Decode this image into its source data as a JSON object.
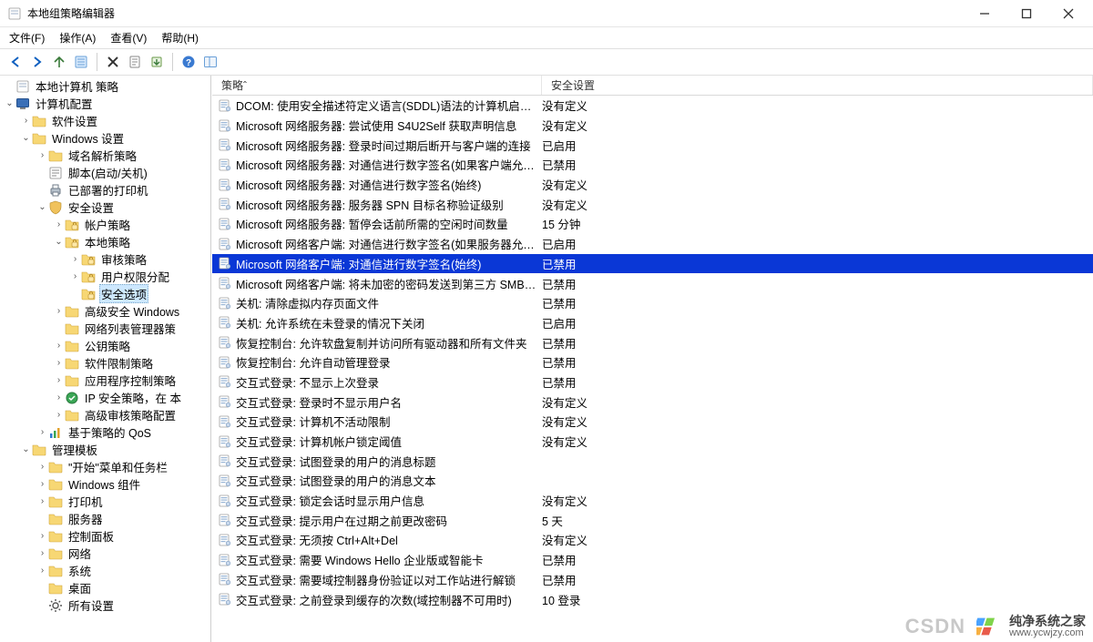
{
  "window": {
    "title": "本地组策略编辑器",
    "min_tooltip": "最小化",
    "max_tooltip": "最大化",
    "close_tooltip": "关闭"
  },
  "menu": {
    "file": "文件(F)",
    "action": "操作(A)",
    "view": "查看(V)",
    "help": "帮助(H)"
  },
  "toolbar_icons": [
    "nav-back-icon",
    "nav-forward-icon",
    "nav-up-icon",
    "list-icon",
    "sep",
    "delete-icon",
    "properties-icon",
    "export-icon",
    "sep",
    "help-icon",
    "show-hide-icon"
  ],
  "tree": [
    {
      "depth": 0,
      "expand": "none",
      "icon": "policy-root-icon",
      "label": "本地计算机 策略"
    },
    {
      "depth": 0,
      "expand": "open",
      "icon": "computer-config-icon",
      "label": "计算机配置"
    },
    {
      "depth": 1,
      "expand": "closed",
      "icon": "folder-icon",
      "label": "软件设置"
    },
    {
      "depth": 1,
      "expand": "open",
      "icon": "folder-icon",
      "label": "Windows 设置"
    },
    {
      "depth": 2,
      "expand": "closed",
      "icon": "folder-icon",
      "label": "域名解析策略"
    },
    {
      "depth": 2,
      "expand": "none",
      "icon": "script-icon",
      "label": "脚本(启动/关机)"
    },
    {
      "depth": 2,
      "expand": "none",
      "icon": "printer-icon",
      "label": "已部署的打印机"
    },
    {
      "depth": 2,
      "expand": "open",
      "icon": "security-icon",
      "label": "安全设置"
    },
    {
      "depth": 3,
      "expand": "closed",
      "icon": "folder-lock-icon",
      "label": "帐户策略"
    },
    {
      "depth": 3,
      "expand": "open",
      "icon": "folder-lock-icon",
      "label": "本地策略"
    },
    {
      "depth": 4,
      "expand": "closed",
      "icon": "folder-lock-icon",
      "label": "审核策略"
    },
    {
      "depth": 4,
      "expand": "closed",
      "icon": "folder-lock-icon",
      "label": "用户权限分配"
    },
    {
      "depth": 4,
      "expand": "none",
      "icon": "folder-lock-icon",
      "label": "安全选项",
      "selected": true
    },
    {
      "depth": 3,
      "expand": "closed",
      "icon": "folder-icon",
      "label": "高级安全 Windows"
    },
    {
      "depth": 3,
      "expand": "none",
      "icon": "folder-icon",
      "label": "网络列表管理器策"
    },
    {
      "depth": 3,
      "expand": "closed",
      "icon": "folder-icon",
      "label": "公钥策略"
    },
    {
      "depth": 3,
      "expand": "closed",
      "icon": "folder-icon",
      "label": "软件限制策略"
    },
    {
      "depth": 3,
      "expand": "closed",
      "icon": "folder-icon",
      "label": "应用程序控制策略"
    },
    {
      "depth": 3,
      "expand": "closed",
      "icon": "ipsec-icon",
      "label": "IP 安全策略，在 本"
    },
    {
      "depth": 3,
      "expand": "closed",
      "icon": "folder-icon",
      "label": "高级审核策略配置"
    },
    {
      "depth": 2,
      "expand": "closed",
      "icon": "qos-icon",
      "label": "基于策略的 QoS"
    },
    {
      "depth": 1,
      "expand": "open",
      "icon": "folder-icon",
      "label": "管理模板"
    },
    {
      "depth": 2,
      "expand": "closed",
      "icon": "folder-icon",
      "label": "\"开始\"菜单和任务栏"
    },
    {
      "depth": 2,
      "expand": "closed",
      "icon": "folder-icon",
      "label": "Windows 组件"
    },
    {
      "depth": 2,
      "expand": "closed",
      "icon": "folder-icon",
      "label": "打印机"
    },
    {
      "depth": 2,
      "expand": "none",
      "icon": "folder-icon",
      "label": "服务器"
    },
    {
      "depth": 2,
      "expand": "closed",
      "icon": "folder-icon",
      "label": "控制面板"
    },
    {
      "depth": 2,
      "expand": "closed",
      "icon": "folder-icon",
      "label": "网络"
    },
    {
      "depth": 2,
      "expand": "closed",
      "icon": "folder-icon",
      "label": "系统"
    },
    {
      "depth": 2,
      "expand": "none",
      "icon": "folder-icon",
      "label": "桌面"
    },
    {
      "depth": 2,
      "expand": "none",
      "icon": "settings-icon",
      "label": "所有设置"
    }
  ],
  "columns": {
    "policy": "策略",
    "setting": "安全设置"
  },
  "rows": [
    {
      "policy": "DCOM: 使用安全描述符定义语言(SDDL)语法的计算机启动...",
      "setting": "没有定义"
    },
    {
      "policy": "Microsoft 网络服务器: 尝试使用 S4U2Self 获取声明信息",
      "setting": "没有定义"
    },
    {
      "policy": "Microsoft 网络服务器: 登录时间过期后断开与客户端的连接",
      "setting": "已启用"
    },
    {
      "policy": "Microsoft 网络服务器: 对通信进行数字签名(如果客户端允许)",
      "setting": "已禁用"
    },
    {
      "policy": "Microsoft 网络服务器: 对通信进行数字签名(始终)",
      "setting": "没有定义"
    },
    {
      "policy": "Microsoft 网络服务器: 服务器 SPN 目标名称验证级别",
      "setting": "没有定义"
    },
    {
      "policy": "Microsoft 网络服务器: 暂停会话前所需的空闲时间数量",
      "setting": "15 分钟"
    },
    {
      "policy": "Microsoft 网络客户端: 对通信进行数字签名(如果服务器允许)",
      "setting": "已启用"
    },
    {
      "policy": "Microsoft 网络客户端: 对通信进行数字签名(始终)",
      "setting": "已禁用",
      "selected": true
    },
    {
      "policy": "Microsoft 网络客户端: 将未加密的密码发送到第三方 SMB ...",
      "setting": "已禁用"
    },
    {
      "policy": "关机: 清除虚拟内存页面文件",
      "setting": "已禁用"
    },
    {
      "policy": "关机: 允许系统在未登录的情况下关闭",
      "setting": "已启用"
    },
    {
      "policy": "恢复控制台: 允许软盘复制并访问所有驱动器和所有文件夹",
      "setting": "已禁用"
    },
    {
      "policy": "恢复控制台: 允许自动管理登录",
      "setting": "已禁用"
    },
    {
      "policy": "交互式登录: 不显示上次登录",
      "setting": "已禁用"
    },
    {
      "policy": "交互式登录: 登录时不显示用户名",
      "setting": "没有定义"
    },
    {
      "policy": "交互式登录: 计算机不活动限制",
      "setting": "没有定义"
    },
    {
      "policy": "交互式登录: 计算机帐户锁定阈值",
      "setting": "没有定义"
    },
    {
      "policy": "交互式登录: 试图登录的用户的消息标题",
      "setting": ""
    },
    {
      "policy": "交互式登录: 试图登录的用户的消息文本",
      "setting": ""
    },
    {
      "policy": "交互式登录: 锁定会话时显示用户信息",
      "setting": "没有定义"
    },
    {
      "policy": "交互式登录: 提示用户在过期之前更改密码",
      "setting": "5 天"
    },
    {
      "policy": "交互式登录: 无须按 Ctrl+Alt+Del",
      "setting": "没有定义"
    },
    {
      "policy": "交互式登录: 需要 Windows Hello 企业版或智能卡",
      "setting": "已禁用"
    },
    {
      "policy": "交互式登录: 需要域控制器身份验证以对工作站进行解锁",
      "setting": "已禁用"
    },
    {
      "policy": "交互式登录: 之前登录到缓存的次数(域控制器不可用时)",
      "setting": "10 登录"
    }
  ],
  "footer": {
    "csdn": "CSDN",
    "brand": "纯净系统之家",
    "url": "www.ycwjzy.com"
  }
}
